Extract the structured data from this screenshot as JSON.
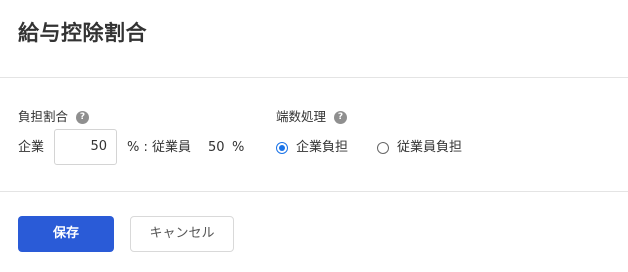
{
  "dialog": {
    "title": "給与控除割合"
  },
  "burden_ratio": {
    "label": "負担割合",
    "help_icon": "question-circle-icon",
    "company_label": "企業",
    "company_value": "50",
    "separator": "% : 従業員",
    "employee_value": "50",
    "employee_unit": "%"
  },
  "rounding": {
    "label": "端数処理",
    "help_icon": "question-circle-icon",
    "options": [
      {
        "label": "企業負担",
        "selected": true
      },
      {
        "label": "従業員負担",
        "selected": false
      }
    ]
  },
  "actions": {
    "save_label": "保存",
    "cancel_label": "キャンセル"
  },
  "colors": {
    "primary": "#2a5bd7",
    "radio_accent": "#1a73e8",
    "help_icon_bg": "#8f8f8f",
    "divider": "#e4e4e4"
  }
}
